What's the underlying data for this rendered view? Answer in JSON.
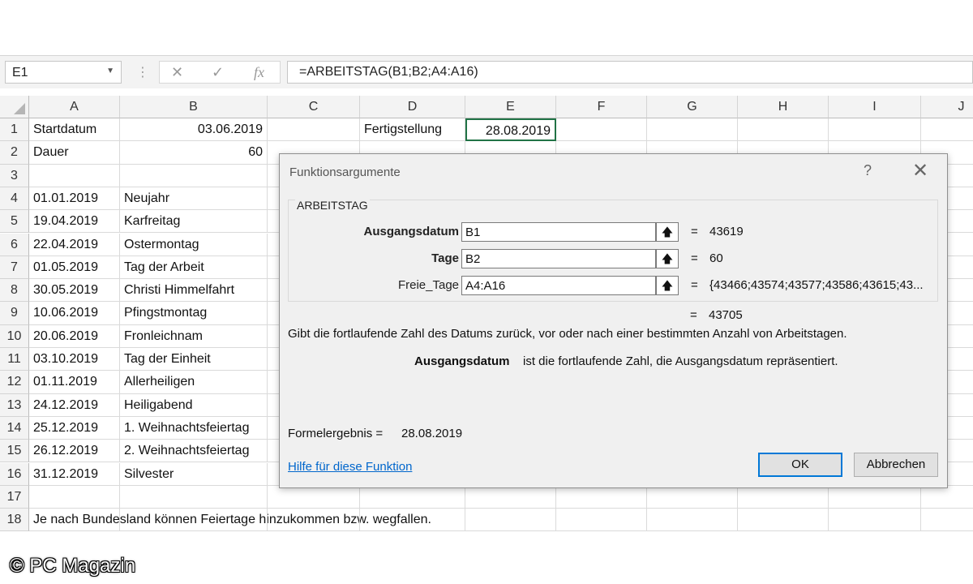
{
  "formula_bar": {
    "name_box": "E1",
    "formula": "=ARBEITSTAG(B1;B2;A4:A16)"
  },
  "columns": [
    "A",
    "B",
    "C",
    "D",
    "E",
    "F",
    "G",
    "H",
    "I",
    "J"
  ],
  "rows": [
    "1",
    "2",
    "3",
    "4",
    "5",
    "6",
    "7",
    "8",
    "9",
    "10",
    "11",
    "12",
    "13",
    "14",
    "15",
    "16",
    "17",
    "18"
  ],
  "cells": {
    "A1": "Startdatum",
    "B1": "03.06.2019",
    "D1": "Fertigstellung",
    "E1": "28.08.2019",
    "A2": "Dauer",
    "B2": "60",
    "A4": "01.01.2019",
    "B4": "Neujahr",
    "A5": "19.04.2019",
    "B5": "Karfreitag",
    "A6": "22.04.2019",
    "B6": "Ostermontag",
    "A7": "01.05.2019",
    "B7": "Tag der Arbeit",
    "A8": "30.05.2019",
    "B8": "Christi Himmelfahrt",
    "A9": "10.06.2019",
    "B9": "Pfingstmontag",
    "A10": "20.06.2019",
    "B10": "Fronleichnam",
    "A11": "03.10.2019",
    "B11": "Tag der Einheit",
    "A12": "01.11.2019",
    "B12": "Allerheiligen",
    "A13": "24.12.2019",
    "B13": "Heiligabend",
    "A14": "25.12.2019",
    "B14": "1. Weihnachtsfeiertag",
    "A15": "26.12.2019",
    "B15": "2. Weihnachtsfeiertag",
    "A16": "31.12.2019",
    "B16": "Silvester",
    "A18": "Je nach Bundesland können Feiertage hinzukommen bzw. wegfallen."
  },
  "dialog": {
    "title": "Funktionsargumente",
    "help": "?",
    "close": "✕",
    "function_name": "ARBEITSTAG",
    "args": [
      {
        "label": "Ausgangsdatum",
        "value": "B1",
        "result": "43619"
      },
      {
        "label": "Tage",
        "value": "B2",
        "result": "60"
      },
      {
        "label": "Freie_Tage",
        "value": "A4:A16",
        "result": "{43466;43574;43577;43586;43615;43..."
      }
    ],
    "eq": "=",
    "overall_result": "43705",
    "description": "Gibt die fortlaufende Zahl des Datums zurück, vor oder nach einer bestimmten Anzahl von Arbeitstagen.",
    "param_name": "Ausgangsdatum",
    "param_desc": "ist die fortlaufende Zahl, die Ausgangsdatum repräsentiert.",
    "formula_result_label": "Formelergebnis =",
    "formula_result_value": "28.08.2019",
    "help_link": "Hilfe für diese Funktion",
    "ok": "OK",
    "cancel": "Abbrechen"
  },
  "watermark": "© PC Magazin"
}
